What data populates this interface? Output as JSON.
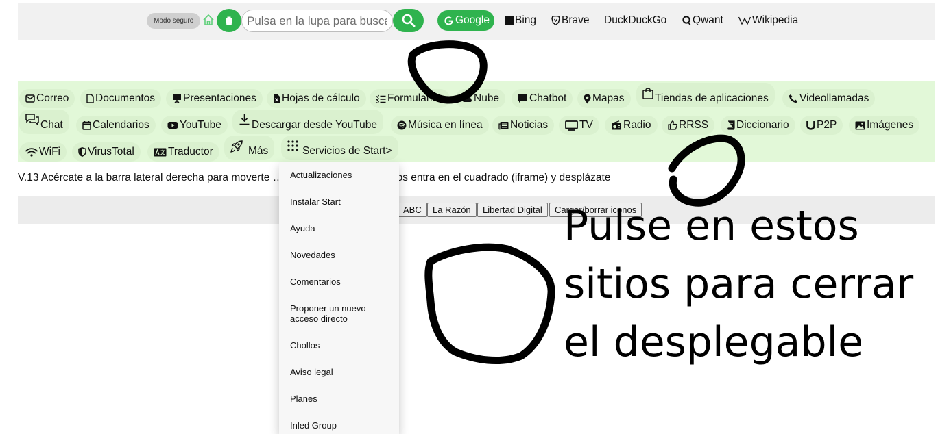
{
  "search": {
    "safe_mode": "Modo seguro",
    "placeholder": "Pulsa en la lupa para buscar",
    "engines": [
      "Google",
      "Bing",
      "Brave",
      "DuckDuckGo",
      "Qwant",
      "Wikipedia"
    ]
  },
  "links": [
    {
      "label": "Correo",
      "icon": "envelope-icon"
    },
    {
      "label": "Documentos",
      "icon": "file-icon"
    },
    {
      "label": "Presentaciones",
      "icon": "presentation-icon"
    },
    {
      "label": "Hojas de cálculo",
      "icon": "spreadsheet-icon"
    },
    {
      "label": "Formularios",
      "icon": "list-check-icon"
    },
    {
      "label": "Nube",
      "icon": "cloud-icon"
    },
    {
      "label": "Chatbot",
      "icon": "chat-bubble-icon"
    },
    {
      "label": "Mapas",
      "icon": "map-pin-icon"
    },
    {
      "label": "Tiendas de aplicaciones",
      "icon": "shopping-bag-icon"
    },
    {
      "label": "Videollamadas",
      "icon": "phone-icon"
    },
    {
      "label": "Chat",
      "icon": "chat-icon"
    },
    {
      "label": "Calendarios",
      "icon": "calendar-icon"
    },
    {
      "label": "YouTube",
      "icon": "youtube-icon"
    },
    {
      "label": "Descargar desde YouTube",
      "icon": "download-icon"
    },
    {
      "label": "Música en línea",
      "icon": "spotify-icon"
    },
    {
      "label": "Noticias",
      "icon": "newspaper-icon"
    },
    {
      "label": "TV",
      "icon": "tv-icon"
    },
    {
      "label": "Radio",
      "icon": "radio-icon"
    },
    {
      "label": "RRSS",
      "icon": "thumbs-up-icon"
    },
    {
      "label": "Diccionario",
      "icon": "book-icon"
    },
    {
      "label": "P2P",
      "icon": "magnet-icon"
    },
    {
      "label": "Imágenes",
      "icon": "image-icon"
    },
    {
      "label": "WiFi",
      "icon": "wifi-icon"
    },
    {
      "label": "VirusTotal",
      "icon": "shield-icon"
    },
    {
      "label": "Traductor",
      "icon": "translate-icon"
    },
    {
      "label": "Más",
      "icon": "rocket-icon"
    },
    {
      "label": "Servicios de Start>",
      "icon": "grid-icon"
    }
  ],
  "dropdown": {
    "items": [
      "Actualizaciones",
      "Instalar Start",
      "Ayuda",
      "Novedades",
      "Comentarios",
      "Proponer un nuevo acceso directo",
      "Chollos",
      "Aviso legal",
      "Planes",
      "Inled Group"
    ]
  },
  "version_text": "V.13 Acércate a la barra lateral derecha para moverte … e dentro de los periódicos entra en el cuadrado (iframe) y desplázate",
  "news": {
    "buttons": [
      "ABC",
      "La Razón",
      "Libertad Digital",
      "Cargar/borrar iconos"
    ]
  },
  "annotation": {
    "text": "Pulse en estos sitios para cerrar el desplegable"
  },
  "colors": {
    "accent_green": "#2fb34e",
    "links_background": "#e2f8d8",
    "search_background": "#f1f1f1"
  }
}
